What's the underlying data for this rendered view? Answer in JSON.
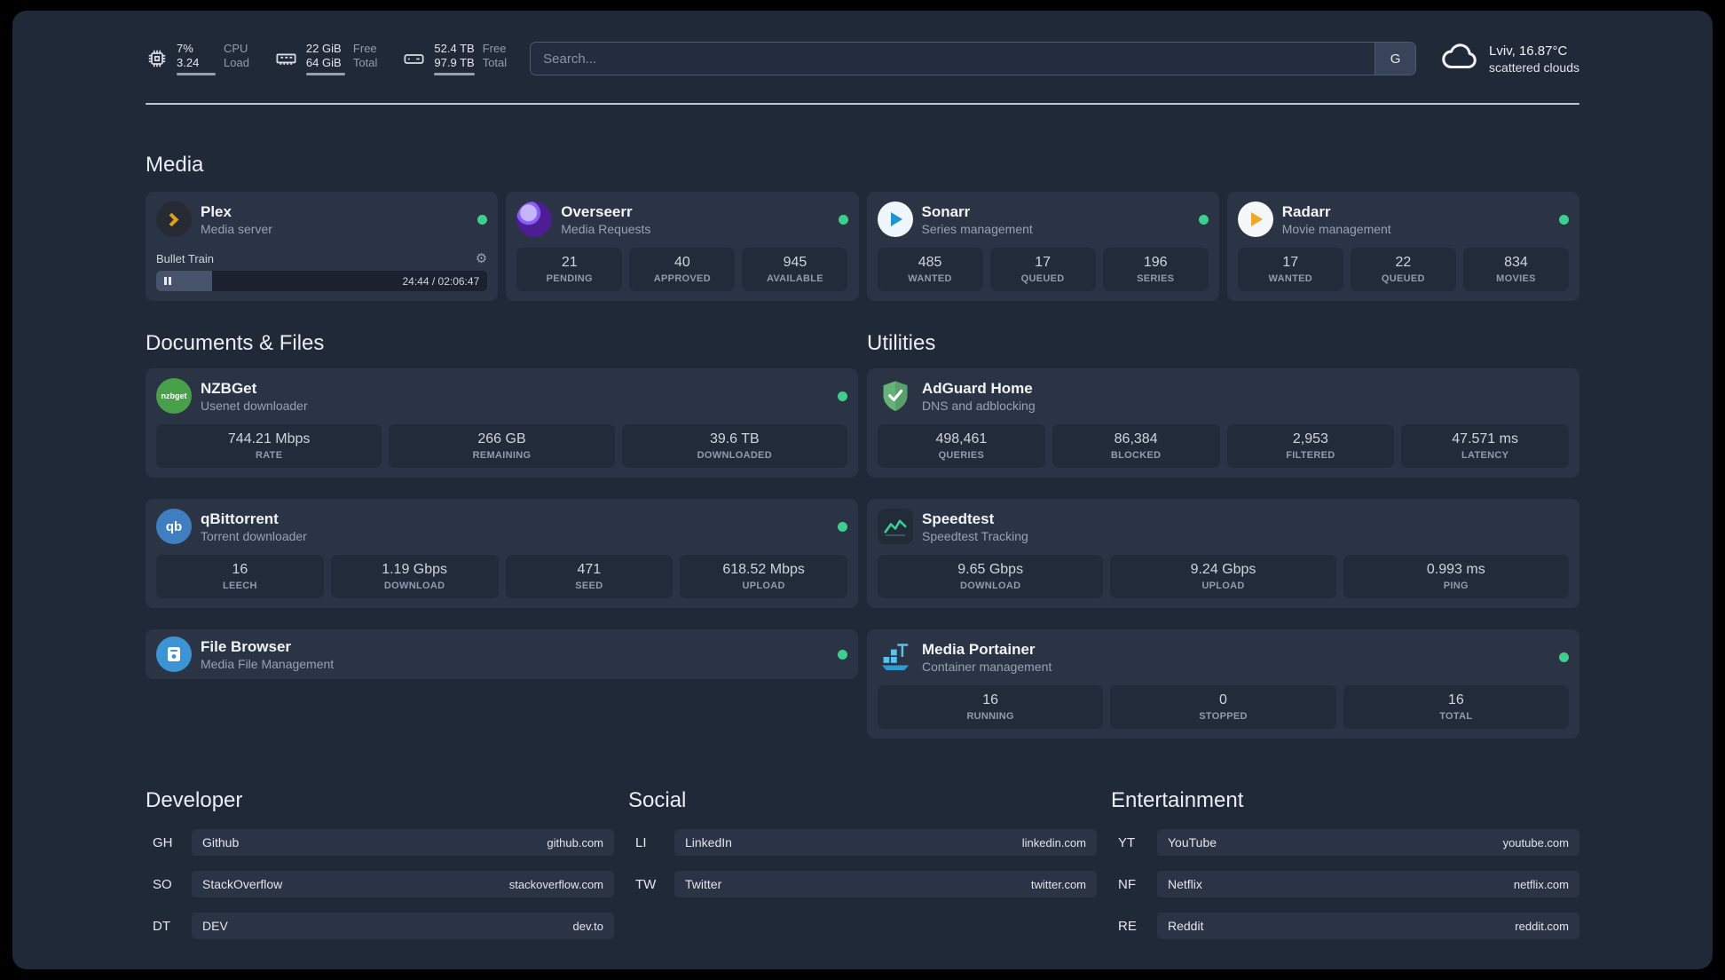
{
  "topbar": {
    "cpu": {
      "value1": "7%",
      "value2": "3.24",
      "label1": "CPU",
      "label2": "Load"
    },
    "ram": {
      "value1": "22 GiB",
      "value2": "64 GiB",
      "label1": "Free",
      "label2": "Total"
    },
    "disk": {
      "value1": "52.4 TB",
      "value2": "97.9 TB",
      "label1": "Free",
      "label2": "Total"
    },
    "search": {
      "placeholder": "Search...",
      "button_label": "G"
    },
    "weather": {
      "location": "Lviv, 16.87°C",
      "condition": "scattered clouds"
    }
  },
  "sections": {
    "media": "Media",
    "documents": "Documents & Files",
    "utilities": "Utilities",
    "developer": "Developer",
    "social": "Social",
    "entertainment": "Entertainment"
  },
  "services": {
    "plex": {
      "name": "Plex",
      "desc": "Media server",
      "now_playing": "Bullet Train",
      "progress_time": "24:44 / 02:06:47",
      "progress_percent": 17
    },
    "overseerr": {
      "name": "Overseerr",
      "desc": "Media Requests",
      "stats": [
        {
          "value": "21",
          "label": "PENDING"
        },
        {
          "value": "40",
          "label": "APPROVED"
        },
        {
          "value": "945",
          "label": "AVAILABLE"
        }
      ]
    },
    "sonarr": {
      "name": "Sonarr",
      "desc": "Series management",
      "stats": [
        {
          "value": "485",
          "label": "WANTED"
        },
        {
          "value": "17",
          "label": "QUEUED"
        },
        {
          "value": "196",
          "label": "SERIES"
        }
      ]
    },
    "radarr": {
      "name": "Radarr",
      "desc": "Movie management",
      "stats": [
        {
          "value": "17",
          "label": "WANTED"
        },
        {
          "value": "22",
          "label": "QUEUED"
        },
        {
          "value": "834",
          "label": "MOVIES"
        }
      ]
    },
    "nzbget": {
      "name": "NZBGet",
      "desc": "Usenet downloader",
      "stats": [
        {
          "value": "744.21 Mbps",
          "label": "RATE"
        },
        {
          "value": "266 GB",
          "label": "REMAINING"
        },
        {
          "value": "39.6 TB",
          "label": "DOWNLOADED"
        }
      ]
    },
    "qbittorrent": {
      "name": "qBittorrent",
      "desc": "Torrent downloader",
      "stats": [
        {
          "value": "16",
          "label": "LEECH"
        },
        {
          "value": "1.19 Gbps",
          "label": "DOWNLOAD"
        },
        {
          "value": "471",
          "label": "SEED"
        },
        {
          "value": "618.52 Mbps",
          "label": "UPLOAD"
        }
      ]
    },
    "filebrowser": {
      "name": "File Browser",
      "desc": "Media File Management"
    },
    "adguard": {
      "name": "AdGuard Home",
      "desc": "DNS and adblocking",
      "stats": [
        {
          "value": "498,461",
          "label": "QUERIES"
        },
        {
          "value": "86,384",
          "label": "BLOCKED"
        },
        {
          "value": "2,953",
          "label": "FILTERED"
        },
        {
          "value": "47.571 ms",
          "label": "LATENCY"
        }
      ]
    },
    "speedtest": {
      "name": "Speedtest",
      "desc": "Speedtest Tracking",
      "stats": [
        {
          "value": "9.65 Gbps",
          "label": "DOWNLOAD"
        },
        {
          "value": "9.24 Gbps",
          "label": "UPLOAD"
        },
        {
          "value": "0.993 ms",
          "label": "PING"
        }
      ]
    },
    "portainer": {
      "name": "Media Portainer",
      "desc": "Container management",
      "stats": [
        {
          "value": "16",
          "label": "RUNNING"
        },
        {
          "value": "0",
          "label": "STOPPED"
        },
        {
          "value": "16",
          "label": "TOTAL"
        }
      ]
    }
  },
  "bookmarks": {
    "developer": [
      {
        "abbr": "GH",
        "name": "Github",
        "url": "github.com"
      },
      {
        "abbr": "SO",
        "name": "StackOverflow",
        "url": "stackoverflow.com"
      },
      {
        "abbr": "DT",
        "name": "DEV",
        "url": "dev.to"
      }
    ],
    "social": [
      {
        "abbr": "LI",
        "name": "LinkedIn",
        "url": "linkedin.com"
      },
      {
        "abbr": "TW",
        "name": "Twitter",
        "url": "twitter.com"
      }
    ],
    "entertainment": [
      {
        "abbr": "YT",
        "name": "YouTube",
        "url": "youtube.com"
      },
      {
        "abbr": "NF",
        "name": "Netflix",
        "url": "netflix.com"
      },
      {
        "abbr": "RE",
        "name": "Reddit",
        "url": "reddit.com"
      }
    ]
  },
  "icons": {
    "cpu": "chip",
    "ram": "memory-stick",
    "disk": "hard-drive",
    "weather": "cloud",
    "gear_glyph": "⚙",
    "plex": "chevron-right",
    "overseerr": "swirl",
    "sonarr": "play-triangle",
    "radarr": "play-triangle",
    "nzbget_text": "nzbget",
    "qbittorrent_text": "qb",
    "filebrowser": "floppy-disk",
    "adguard": "shield-check",
    "speedtest": "line-graph",
    "portainer": "crane-containers"
  },
  "colors": {
    "background": "#202938",
    "card": "#2b3444",
    "stat_block": "#222b3a",
    "status_online": "#3ecf8e",
    "plex_accent": "#e5a00d",
    "divider": "#cfd8e3"
  }
}
